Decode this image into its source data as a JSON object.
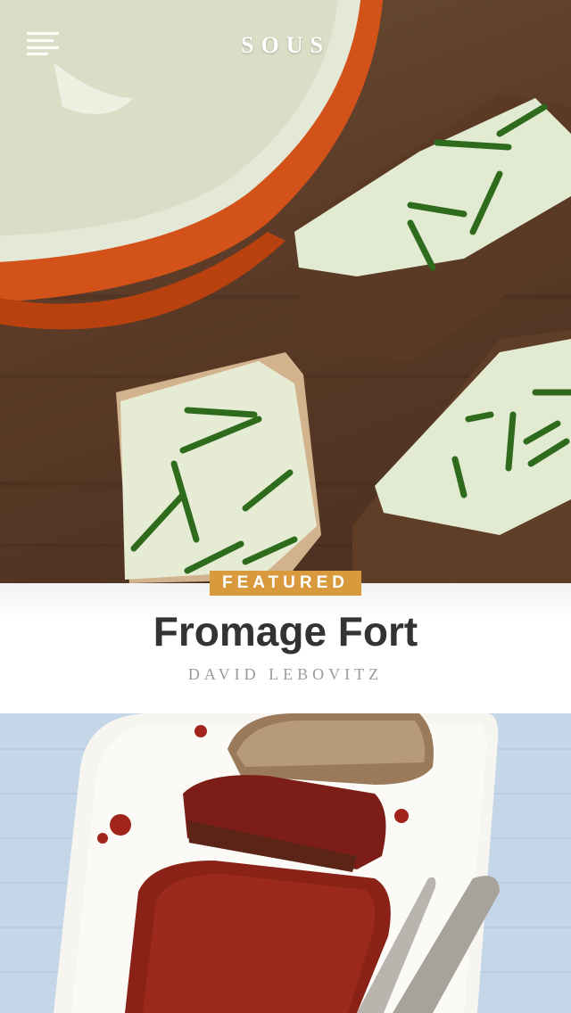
{
  "header": {
    "app_title": "SOUS",
    "menu_icon": "hamburger-menu-icon"
  },
  "featured": {
    "badge": "FEATURED",
    "title": "Fromage Fort",
    "author": "DAVID LEBOVITZ",
    "image": "cheese-spread-on-toast-with-chives-photo"
  },
  "next_card": {
    "image": "sliced-meatloaf-on-platter-photo"
  },
  "colors": {
    "badge": "#d99a3e",
    "title": "#333333",
    "author": "#9a9a9a",
    "header_text": "#ffffff"
  }
}
